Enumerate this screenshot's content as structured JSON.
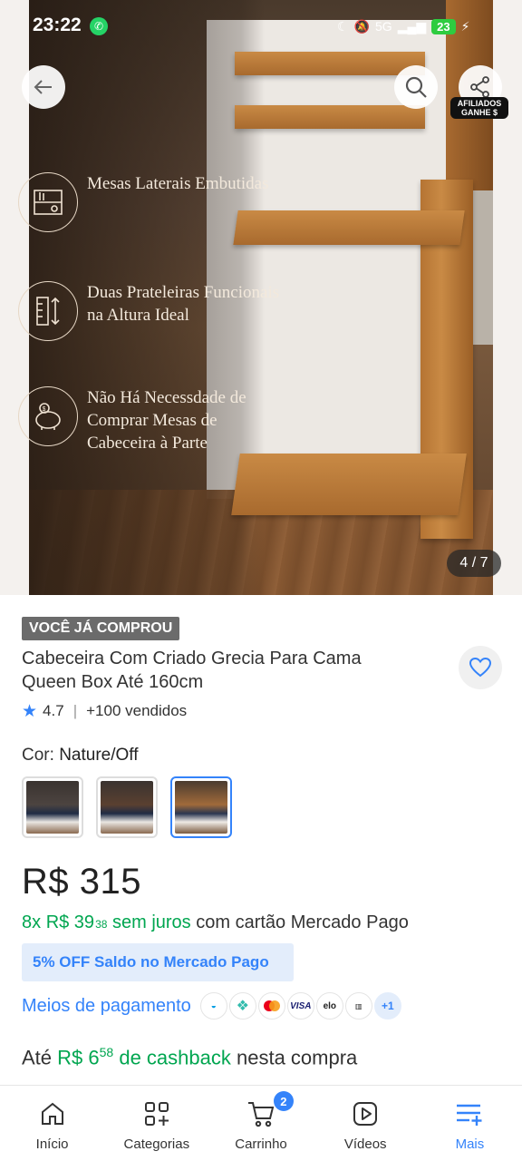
{
  "status_bar": {
    "time": "23:22",
    "network": "5G",
    "battery": "23"
  },
  "gallery": {
    "counter": "4 / 7",
    "share_badge": [
      "AFILIADOS",
      "GANHE $"
    ],
    "features": [
      {
        "icon": "shelves-icon",
        "text": "Mesas Laterais Embutidas"
      },
      {
        "icon": "ruler-height-icon",
        "text": "Duas Prateleiras Funcionais na Altura Ideal"
      },
      {
        "icon": "piggy-bank-icon",
        "text": "Não Há Necessdade de Comprar Mesas de Cabeceira à Parte"
      }
    ]
  },
  "product": {
    "purchased_badge": "VOCÊ JÁ COMPROU",
    "title": "Cabeceira Com Criado Grecia Para Cama Queen Box Até 160cm",
    "rating": "4.7",
    "sold": "+100 vendidos",
    "color_label": "Cor:",
    "color_value": "Nature/Off",
    "variant_count_selected": 3,
    "price": "R$ 315",
    "installments": {
      "count": "8x",
      "currency": "R$ 39",
      "cents": "38",
      "interest": "sem juros",
      "method": "com cartão Mercado Pago"
    },
    "discount": "5% OFF Saldo no Mercado Pago",
    "payment_link": "Meios de pagamento",
    "payment_more": "+1",
    "cashback": {
      "prefix": "Até",
      "amount": "R$ 6",
      "cents": "58",
      "label": "de cashback",
      "suffix": "nesta compra"
    }
  },
  "nav": {
    "items": [
      {
        "label": "Início",
        "icon": "home-icon"
      },
      {
        "label": "Categorias",
        "icon": "categories-icon"
      },
      {
        "label": "Carrinho",
        "icon": "cart-icon",
        "badge": "2"
      },
      {
        "label": "Vídeos",
        "icon": "video-icon"
      },
      {
        "label": "Mais",
        "icon": "menu-plus-icon",
        "active": true
      }
    ]
  },
  "colors": {
    "accent": "#3483fa",
    "green": "#00a650",
    "badge_gray": "#6b6b6b"
  }
}
